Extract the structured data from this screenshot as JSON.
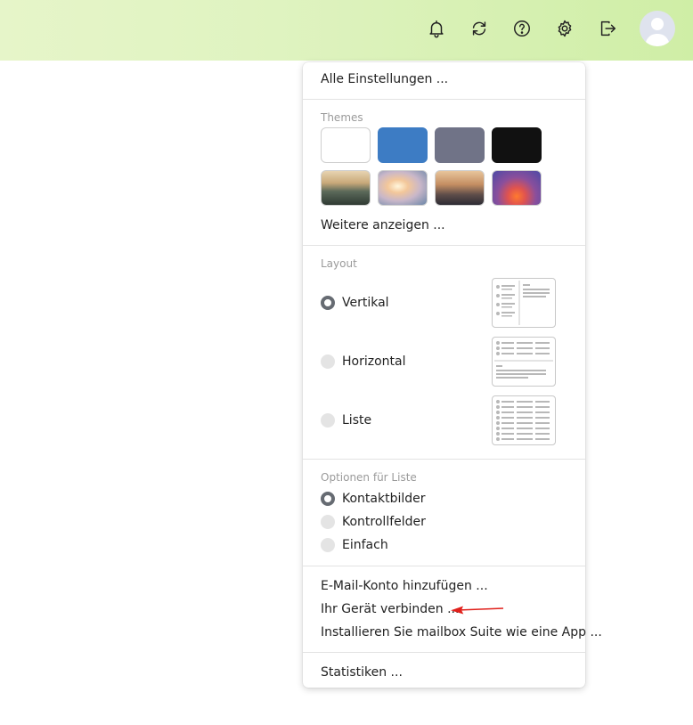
{
  "topbar": {
    "icons": [
      "bell-icon",
      "sync-icon",
      "help-icon",
      "gear-icon",
      "logout-icon"
    ],
    "gradient": [
      "#e6f5c9",
      "#cfeea6"
    ]
  },
  "menu": {
    "all_settings": "Alle Einstellungen ...",
    "themes": {
      "label": "Themes",
      "solid_colors": [
        "#ffffff",
        "#3d7cc4",
        "#707387",
        "#111111"
      ],
      "images": [
        "mountain-landscape",
        "sunset-beach",
        "city-skyline",
        "purple-orange-gradient"
      ],
      "more": "Weitere anzeigen ..."
    },
    "layout": {
      "label": "Layout",
      "options": [
        "Vertikal",
        "Horizontal",
        "Liste"
      ],
      "selected": "Vertikal"
    },
    "list_options": {
      "label": "Optionen für Liste",
      "options": [
        "Kontaktbilder",
        "Kontrollfelder",
        "Einfach"
      ],
      "selected": "Kontaktbilder"
    },
    "actions": [
      "E-Mail-Konto hinzufügen ...",
      "Ihr Gerät verbinden ...",
      "Installieren Sie mailbox Suite wie eine App ..."
    ],
    "statistics": "Statistiken ..."
  },
  "annotation": {
    "color": "#e0201b"
  }
}
